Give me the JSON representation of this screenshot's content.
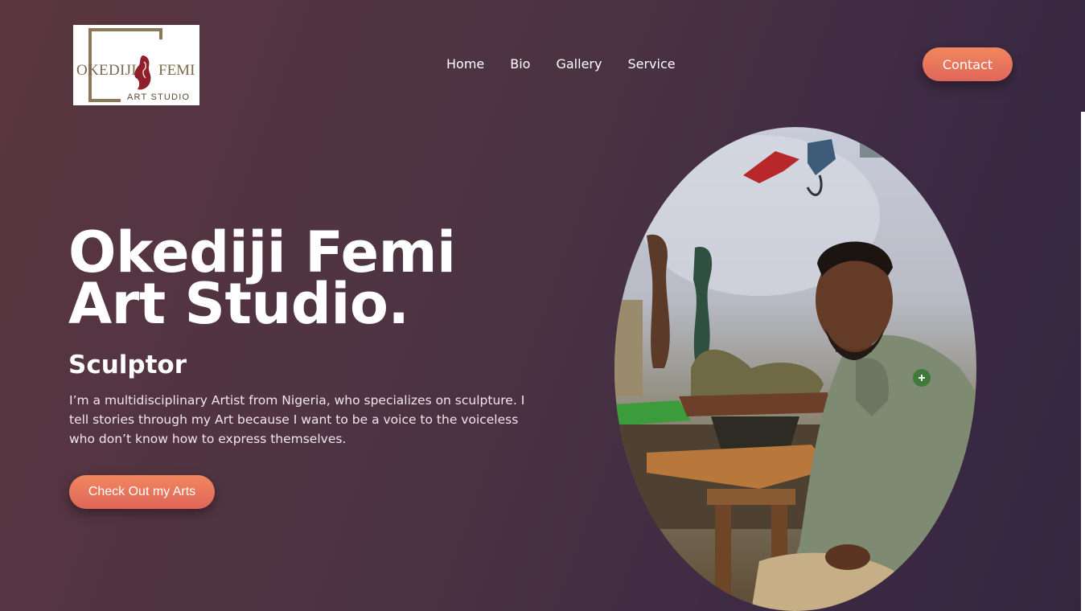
{
  "header": {
    "logo": {
      "name_left": "OKEDIJI",
      "name_right": "FEMI",
      "tagline": "ART STUDIO"
    },
    "nav": [
      "Home",
      "Bio",
      "Gallery",
      "Service"
    ],
    "contact_label": "Contact"
  },
  "hero": {
    "title_line1": "Okediji Femi",
    "title_line2": "Art Studio.",
    "subtitle": "Sculptor",
    "description": "I’m a multidisciplinary Artist from Nigeria, who specializes on sculpture. I tell stories through my Art because I want to be a voice to the voiceless who don’t know how to express themselves.",
    "cta_label": "Check Out my Arts"
  },
  "colors": {
    "accent_start": "#f0875e",
    "accent_end": "#e0665a",
    "background": "#4c3342"
  }
}
